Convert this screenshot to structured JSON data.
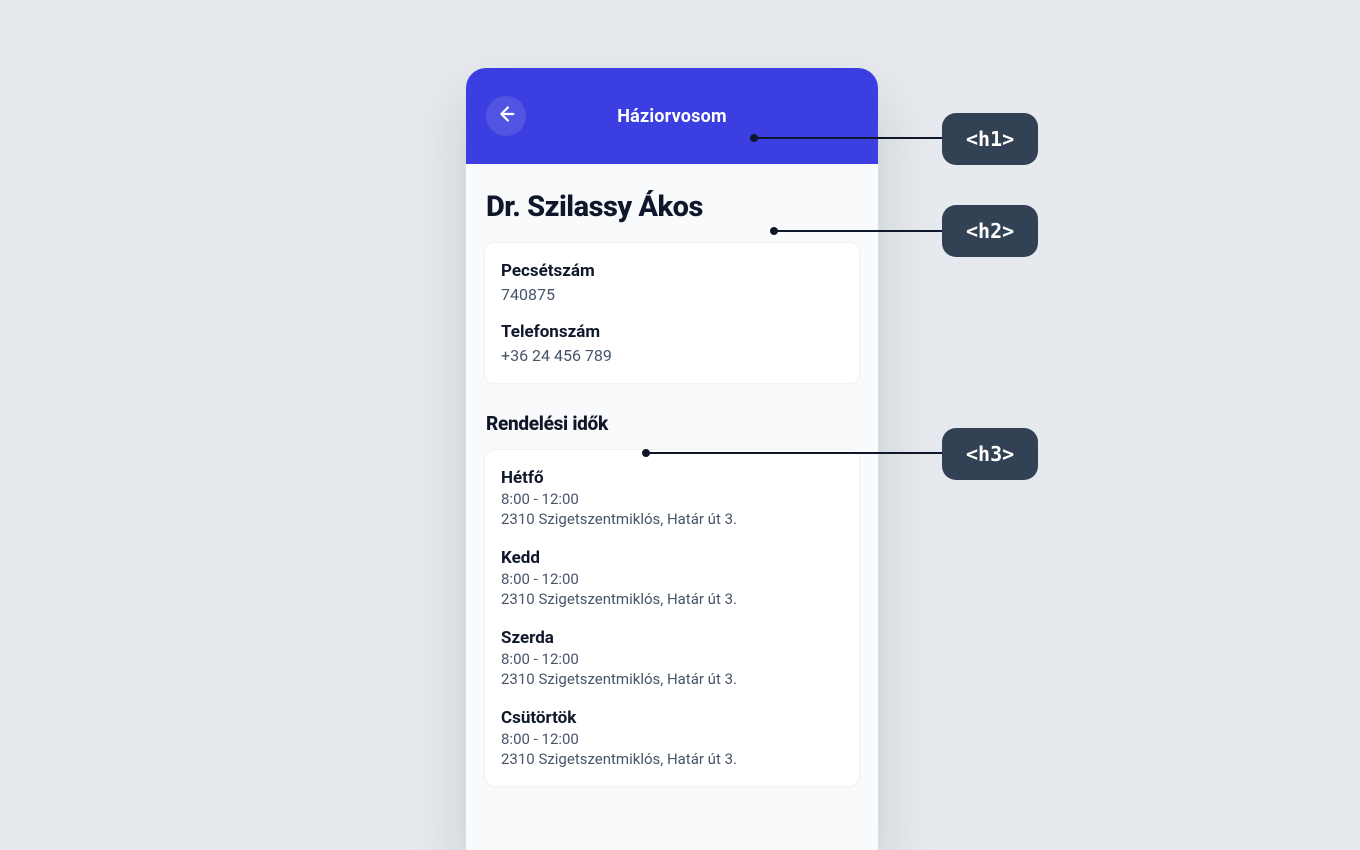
{
  "header": {
    "title": "Háziorvosom"
  },
  "doctor": {
    "name": "Dr. Szilassy Ákos"
  },
  "info": {
    "stampLabel": "Pecsétszám",
    "stampValue": "740875",
    "phoneLabel": "Telefonszám",
    "phoneValue": "+36 24 456 789"
  },
  "hours": {
    "heading": "Rendelési idők",
    "days": [
      {
        "name": "Hétfő",
        "time": "8:00 - 12:00",
        "addr": "2310 Szigetszentmiklós, Határ út 3."
      },
      {
        "name": "Kedd",
        "time": "8:00 - 12:00",
        "addr": "2310 Szigetszentmiklós, Határ út 3."
      },
      {
        "name": "Szerda",
        "time": "8:00 - 12:00",
        "addr": "2310 Szigetszentmiklós, Határ út 3."
      },
      {
        "name": "Csütörtök",
        "time": "8:00 - 12:00",
        "addr": "2310 Szigetszentmiklós, Határ út 3."
      }
    ]
  },
  "annotations": {
    "h1": "<h1>",
    "h2": "<h2>",
    "h3": "<h3>"
  }
}
